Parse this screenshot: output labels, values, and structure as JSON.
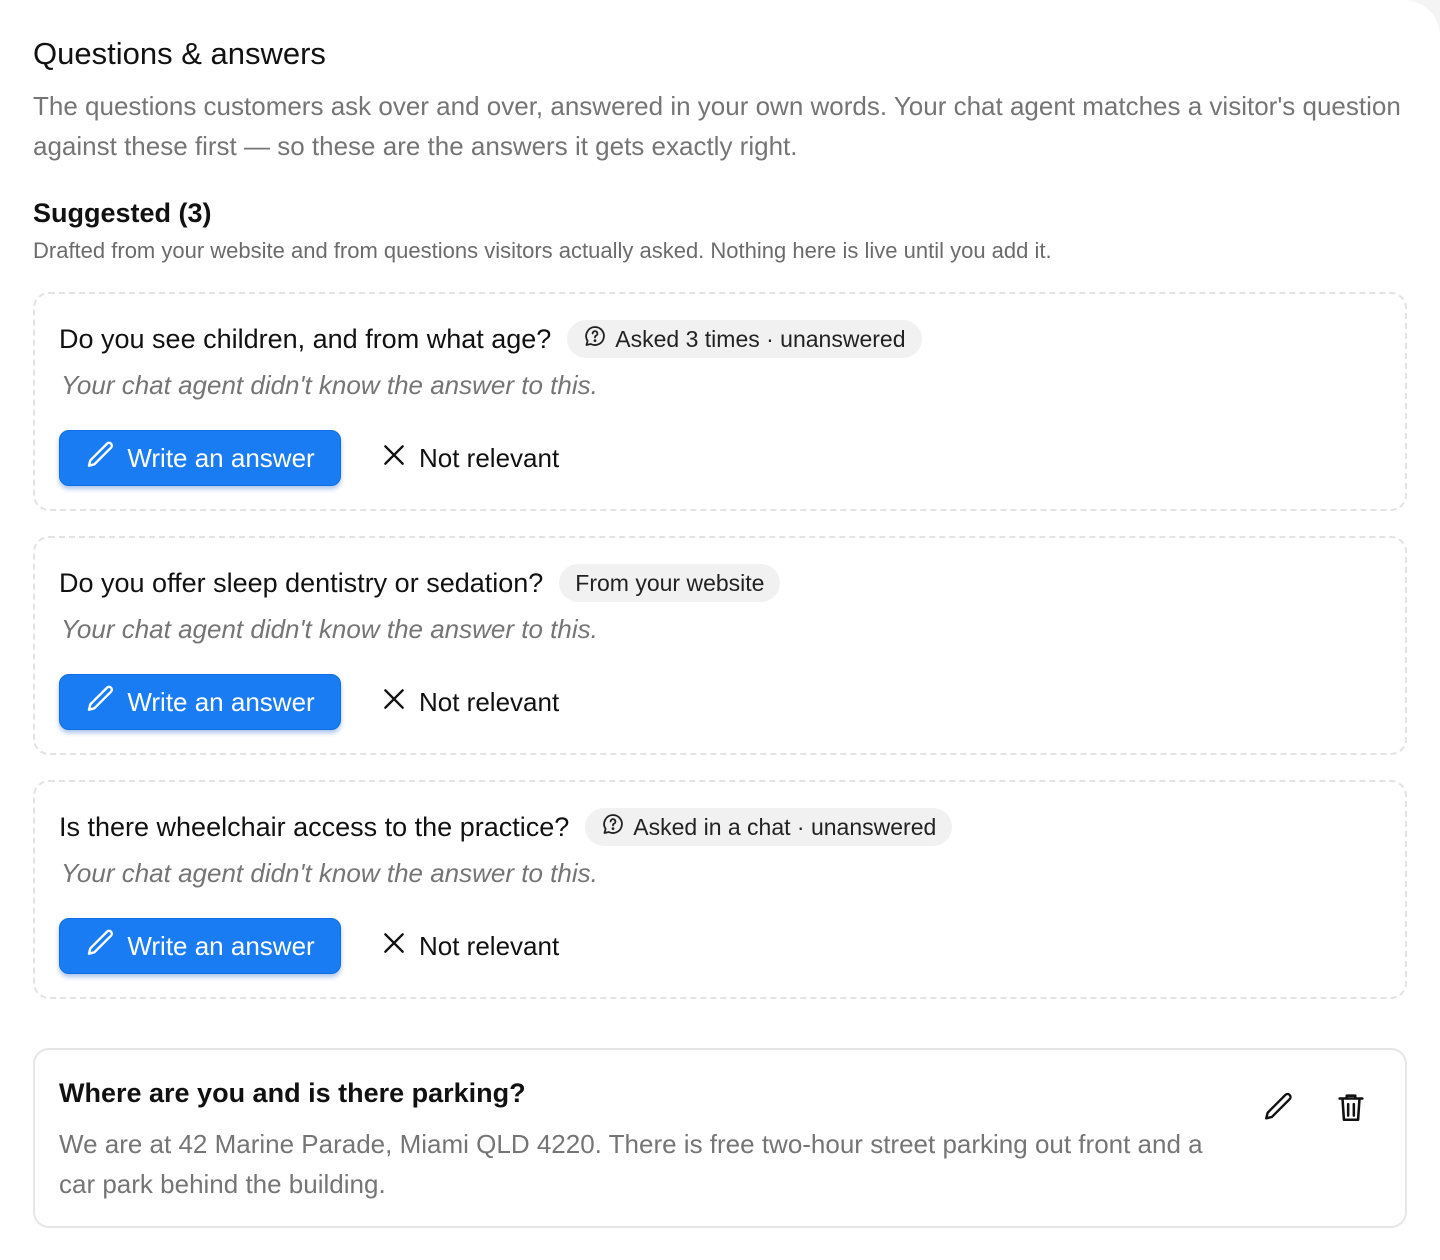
{
  "header": {
    "title": "Questions & answers",
    "description": "The questions customers ask over and over, answered in your own words. Your chat agent matches a visitor's question against these first — so these are the answers it gets exactly right."
  },
  "suggested": {
    "title": "Suggested (3)",
    "subtitle": "Drafted from your website and from questions visitors actually asked. Nothing here is live until you add it.",
    "items": [
      {
        "question": "Do you see children, and from what age?",
        "badge": "Asked 3 times · unanswered",
        "badge_icon": "chat-question-icon",
        "note": "Your chat agent didn't know the answer to this.",
        "write_label": "Write an answer",
        "dismiss_label": "Not relevant"
      },
      {
        "question": "Do you offer sleep dentistry or sedation?",
        "badge": "From your website",
        "badge_icon": "",
        "note": "Your chat agent didn't know the answer to this.",
        "write_label": "Write an answer",
        "dismiss_label": "Not relevant"
      },
      {
        "question": "Is there wheelchair access to the practice?",
        "badge": "Asked in a chat · unanswered",
        "badge_icon": "chat-question-icon",
        "note": "Your chat agent didn't know the answer to this.",
        "write_label": "Write an answer",
        "dismiss_label": "Not relevant"
      }
    ]
  },
  "answered": [
    {
      "question": "Where are you and is there parking?",
      "answer": "We are at 42 Marine Parade, Miami QLD 4220. There is free two-hour street parking out front and a car park behind the building."
    }
  ],
  "colors": {
    "primary_button": "#1a7cf2",
    "muted_text": "#757575",
    "badge_bg": "#f1f1f2"
  }
}
